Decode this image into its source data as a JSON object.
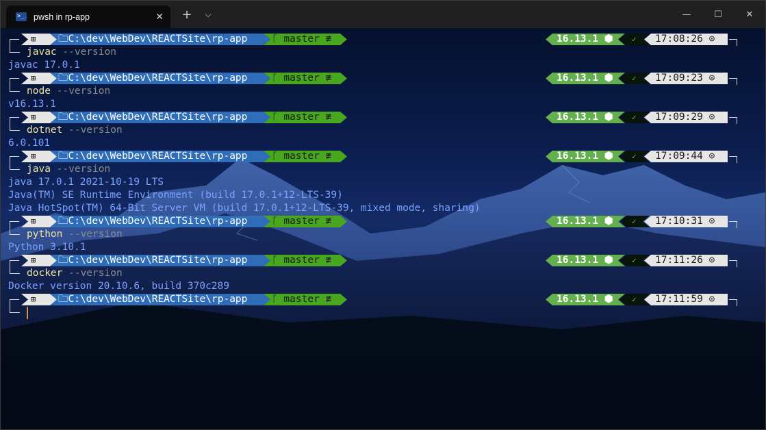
{
  "window": {
    "tab_title": "pwsh in rp-app",
    "tab_icon_glyph": ">_",
    "close_tab_glyph": "✕",
    "new_tab_glyph": "+",
    "dropdown_glyph": "⌵",
    "minimize_glyph": "—",
    "maximize_glyph": "☐",
    "close_glyph": "✕"
  },
  "prompt": {
    "os_glyph": "⊞",
    "path": "🗀C:\\dev\\WebDev\\REACTSite\\rp-app",
    "git": "ᚴ master ≢",
    "node": "16.13.1 ⬢",
    "exit_glyph": "✓"
  },
  "colors": {
    "path_segment": "#2f6db8",
    "git_segment": "#48a61f",
    "node_segment": "#64b04f",
    "time_segment": "#e6e6e6",
    "command": "#f0e6a0",
    "argument": "#8c8c8c",
    "output": "#7aa2ff",
    "cursor": "#e0904a"
  },
  "blocks": [
    {
      "time": "17:08:26 ⊙",
      "cmd": "javac",
      "arg": " --version",
      "output": [
        "javac 17.0.1"
      ]
    },
    {
      "time": "17:09:23 ⊙",
      "cmd": "node",
      "arg": " --version",
      "output": [
        "v16.13.1"
      ]
    },
    {
      "time": "17:09:29 ⊙",
      "cmd": "dotnet",
      "arg": " --version",
      "output": [
        "6.0.101"
      ]
    },
    {
      "time": "17:09:44 ⊙",
      "cmd": "java",
      "arg": " --version",
      "output": [
        "java 17.0.1 2021-10-19 LTS",
        "Java(TM) SE Runtime Environment (build 17.0.1+12-LTS-39)",
        "Java HotSpot(TM) 64-Bit Server VM (build 17.0.1+12-LTS-39, mixed mode, sharing)"
      ]
    },
    {
      "time": "17:10:31 ⊙",
      "cmd": "python",
      "arg": " --version",
      "output": [
        "Python 3.10.1"
      ]
    },
    {
      "time": "17:11:26 ⊙",
      "cmd": "docker",
      "arg": " --version",
      "output": [
        "Docker version 20.10.6, build 370c289"
      ]
    },
    {
      "time": "17:11:59 ⊙",
      "cmd": "",
      "arg": "",
      "output": []
    }
  ]
}
